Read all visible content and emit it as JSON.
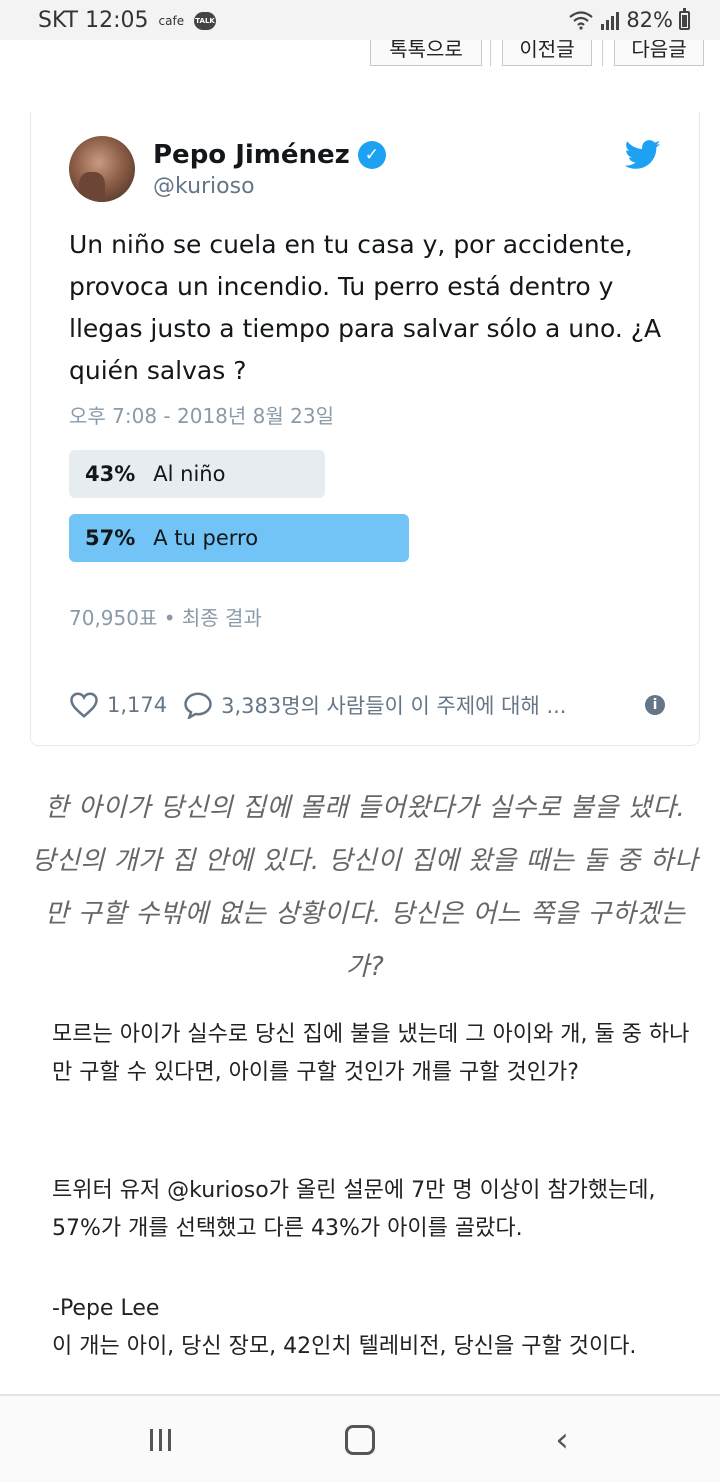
{
  "status_bar": {
    "carrier_time": "SKT 12:05",
    "cafe_label": "cafe",
    "talk_label": "TALK",
    "battery_text": "82%",
    "icons": [
      "wifi-icon",
      "signal-icon",
      "battery-icon"
    ]
  },
  "top_nav": {
    "kakaotalk_share": "톡톡으로",
    "prev_post": "이전글",
    "next_post": "다음글"
  },
  "tweet": {
    "author_name": "Pepo Jiménez",
    "handle": "@kurioso",
    "text": "Un niño se cuela en tu casa y, por accidente, provoca un incendio. Tu perro está dentro y llegas justo a tiempo para salvar sólo a uno. ¿A quién salvas ?",
    "timestamp": "오후 7:08 - 2018년 8월 23일",
    "poll": [
      {
        "percent_text": "43%",
        "label": "Al niño",
        "fraction": 0.43
      },
      {
        "percent_text": "57%",
        "label": "A tu perro",
        "fraction": 0.57
      }
    ],
    "votes": "70,950표 • 최종 결과",
    "likes": "1,174",
    "replies_text": "3,383명의 사람들이 이 주제에 대해 ...",
    "accent_color": "#1da1f2",
    "poll_winner_color": "#71c4f5",
    "poll_other_color": "#e6ecf0"
  },
  "caption": "한 아이가 당신의 집에 몰래 들어왔다가 실수로 불을 냈다. 당신의 개가 집 안에 있다. 당신이 집에 왔을 때는 둘 중 하나만 구할 수밖에 없는 상황이다. 당신은 어느 쪽을 구하겠는가?",
  "body": {
    "paragraph1": "모르는 아이가 실수로 당신 집에 불을 냈는데 그 아이와 개, 둘 중 하나만 구할 수 있다면, 아이를 구할 것인가 개를 구할 것인가?",
    "paragraph2": "트위터 유저 @kurioso가 올린 설문에 7만 명 이상이 참가했는데, 57%가 개를 선택했고 다른 43%가 아이를 골랐다.",
    "comment_author": "-Pepe Lee",
    "comment_text": "이 개는 아이, 당신 장모, 42인치 텔레비전, 당신을 구할 것이다."
  },
  "bottom_nav": {
    "icons": [
      "recent-apps-icon",
      "home-icon",
      "back-icon"
    ]
  }
}
